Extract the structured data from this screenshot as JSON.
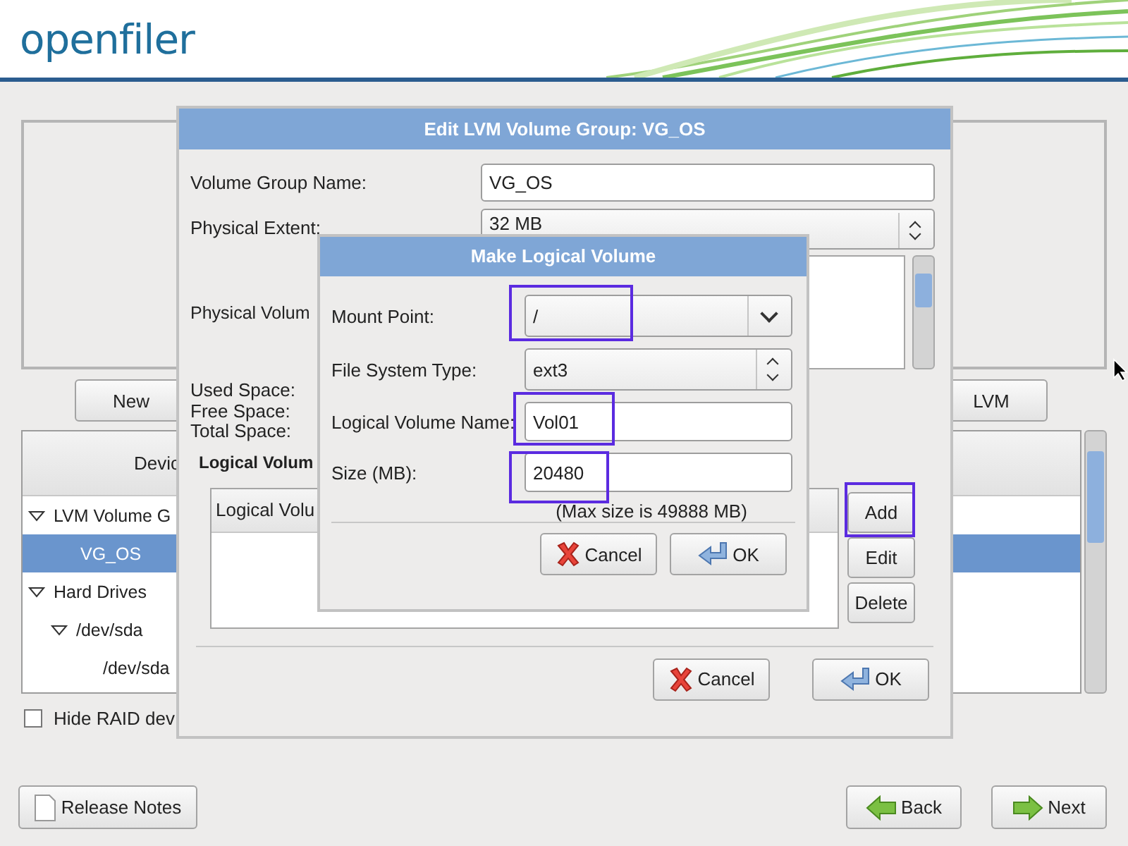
{
  "header": {
    "logo": "openfiler"
  },
  "installer": {
    "buttons": [
      {
        "label": "New"
      },
      {
        "label": "LVM"
      }
    ],
    "device_tree": {
      "column_header": "Devic",
      "rows": [
        {
          "label": "LVM Volume G",
          "expanded": true,
          "selected": false,
          "children": [
            {
              "label": "VG_OS",
              "selected": true
            }
          ]
        },
        {
          "label": "Hard Drives",
          "expanded": true,
          "selected": false,
          "children": [
            {
              "label": "/dev/sda",
              "expanded": true,
              "selected": false,
              "children": [
                {
                  "label": "/dev/sda",
                  "selected": false
                }
              ]
            }
          ]
        }
      ]
    },
    "hide_raid": {
      "label": "Hide RAID dev",
      "checked": false
    },
    "bottom_buttons": [
      {
        "label": "Release Notes",
        "kind": "notes"
      },
      {
        "label": "Back",
        "kind": "back"
      },
      {
        "label": "Next",
        "kind": "next"
      }
    ]
  },
  "edit_dialog": {
    "title": "Edit LVM Volume Group: VG_OS",
    "fields": [
      {
        "label": "Volume Group Name:",
        "kind": "text",
        "value": "VG_OS"
      },
      {
        "label": "Physical Extent:",
        "kind": "combo",
        "value": "32 MB"
      }
    ],
    "physical_volumes_label": "Physical Volum",
    "space_labels": [
      "Used Space:",
      "Free Space:",
      "Total Space:"
    ],
    "logical_volumes_label": "Logical Volum",
    "lv_list": {
      "column_header": "Logical Volu"
    },
    "side_buttons": [
      {
        "label": "Add",
        "highlighted": true
      },
      {
        "label": "Edit",
        "highlighted": false
      },
      {
        "label": "Delete",
        "highlighted": false
      }
    ],
    "buttons": [
      {
        "label": "Cancel",
        "kind": "cancel"
      },
      {
        "label": "OK",
        "kind": "ok"
      }
    ]
  },
  "make_dialog": {
    "title": "Make Logical Volume",
    "fields": [
      {
        "label": "Mount Point:",
        "kind": "dropdown",
        "value": "/",
        "highlighted": true
      },
      {
        "label": "File System Type:",
        "kind": "combo",
        "value": "ext3",
        "highlighted": false
      },
      {
        "label": "Logical Volume Name:",
        "kind": "text",
        "value": "Vol01",
        "highlighted": true
      },
      {
        "label": "Size (MB):",
        "kind": "text",
        "value": "20480",
        "highlighted": true
      }
    ],
    "note": "(Max size is 49888 MB)",
    "buttons": [
      {
        "label": "Cancel",
        "kind": "cancel"
      },
      {
        "label": "OK",
        "kind": "ok"
      }
    ]
  }
}
